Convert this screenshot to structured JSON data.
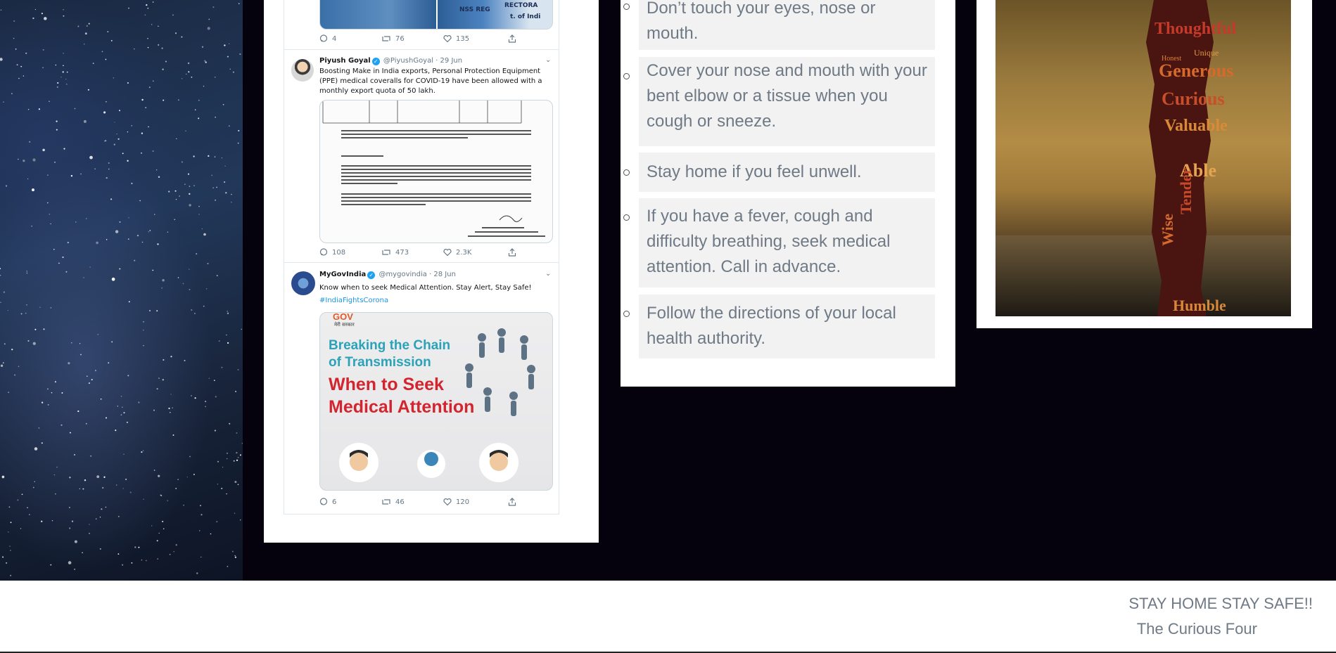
{
  "tweets": [
    {
      "counts": {
        "replies": "4",
        "retweets": "76",
        "likes": "135"
      },
      "media_text": [
        "NSS REG",
        "RECTORA",
        "t. of Indi"
      ]
    },
    {
      "name": "Piyush Goyal",
      "handle": "@PiyushGoyal",
      "date": "· 29 Jun",
      "text": "Boosting Make in India exports, Personal Protection Equipment (PPE) medical coveralls for COVID-19 have been allowed with a monthly export quota of 50 lakh.",
      "counts": {
        "replies": "108",
        "retweets": "473",
        "likes": "2.3K"
      }
    },
    {
      "name": "MyGovIndia",
      "handle": "@mygovindia",
      "date": "· 28 Jun",
      "text": "Know when to seek Medical Attention. Stay Alert, Stay Safe!",
      "hashtag": "#IndiaFightsCorona",
      "media": {
        "brand": "GOV",
        "brand_sub": "मेरी सरकार",
        "line1": "Breaking the Chain",
        "line2": "of Transmission",
        "line3": "When to Seek",
        "line4": "Medical Attention"
      },
      "counts": {
        "replies": "6",
        "retweets": "46",
        "likes": "120"
      }
    }
  ],
  "tips": [
    "Don’t touch your eyes, nose or mouth.",
    "Cover your nose and mouth with your bent elbow or a tissue when you cough or sneeze.",
    "Stay home if you feel unwell.",
    "If you have a fever, cough and difficulty breathing, seek medical attention. Call in advance.",
    "Follow the directions of your local health authority."
  ],
  "silhouette_words": [
    "Thoughtful",
    "Generous",
    "Curious",
    "Valuable",
    "Able",
    "Tender",
    "Wise",
    "Humble",
    "Unique",
    "Honest"
  ],
  "footer": {
    "line1": "STAY HOME STAY SAFE!!",
    "line2": "The Curious Four"
  }
}
